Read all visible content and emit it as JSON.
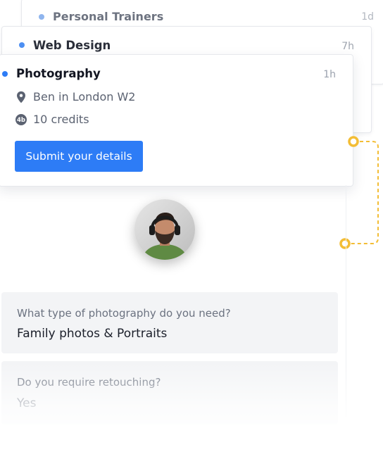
{
  "leads": [
    {
      "title": "Personal Trainers",
      "time": "1d"
    },
    {
      "title": "Web Design",
      "time": "7h"
    },
    {
      "title": "Photography",
      "time": "1h",
      "location": "Ben in London W2",
      "credits": "10 credits",
      "credits_badge": "4b",
      "submit_label": "Submit your details"
    }
  ],
  "questions": [
    {
      "question": "What type of photography do you need?",
      "answer": "Family photos & Portraits"
    },
    {
      "question": "Do you require retouching?",
      "answer": "Yes"
    }
  ],
  "colors": {
    "accent": "#2d7cf6",
    "connector": "#f3bd35",
    "dot_faded": "#8fb5ee",
    "dot_mid": "#4d8ff2",
    "dot_active": "#2d7cf6"
  },
  "icons": [
    "location-pin-icon",
    "credits-icon",
    "user-avatar"
  ]
}
